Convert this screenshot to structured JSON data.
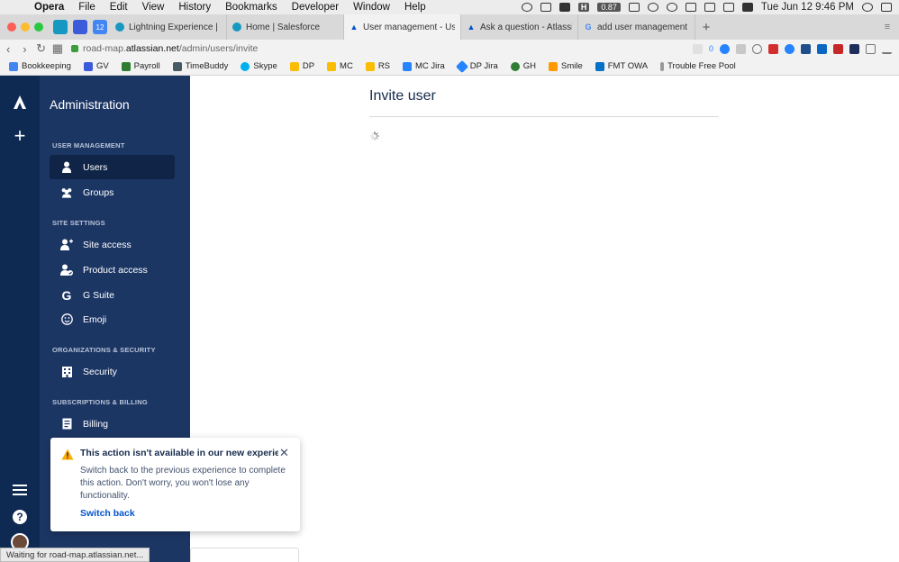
{
  "os_menubar": {
    "items": [
      "Opera",
      "File",
      "Edit",
      "View",
      "History",
      "Bookmarks",
      "Developer",
      "Window",
      "Help"
    ],
    "badge_value": "0.87",
    "clock": "Tue Jun 12  9:46 PM"
  },
  "tabs": [
    {
      "title": "Lightning Experience | Salesf",
      "icon": "salesforce-cloud"
    },
    {
      "title": "Home | Salesforce",
      "icon": "salesforce-cloud"
    },
    {
      "title": "User management - Users",
      "icon": "atlassian-logo",
      "active": true
    },
    {
      "title": "Ask a question - Atlassian Co",
      "icon": "atlassian-logo"
    },
    {
      "title": "add user management page",
      "icon": "google-g"
    }
  ],
  "address_bar": {
    "url_prefix": "road-map.",
    "url_host": "atlassian.net",
    "url_path": "/admin/users/invite",
    "ext_count": "0"
  },
  "bookmarks": [
    {
      "label": "Bookkeeping",
      "color": "#4285f4"
    },
    {
      "label": "GV",
      "color": "#3b5bdb"
    },
    {
      "label": "Payroll",
      "color": "#2e7d32"
    },
    {
      "label": "TimeBuddy",
      "color": "#455a64"
    },
    {
      "label": "Skype",
      "color": "#00aff0"
    },
    {
      "label": "DP",
      "color": "#fbbc04"
    },
    {
      "label": "MC",
      "color": "#fbbc04"
    },
    {
      "label": "RS",
      "color": "#fbbc04"
    },
    {
      "label": "MC Jira",
      "color": "#2684ff"
    },
    {
      "label": "DP Jira",
      "color": "#2684ff"
    },
    {
      "label": "GH",
      "color": "#2e7d32"
    },
    {
      "label": "Smile",
      "color": "#ff9900"
    },
    {
      "label": "FMT OWA",
      "color": "#0072c6"
    },
    {
      "label": "Trouble Free Pool",
      "color": "#999999"
    }
  ],
  "sidebar": {
    "title": "Administration",
    "sections": [
      {
        "heading": "USER MANAGEMENT",
        "items": [
          {
            "label": "Users",
            "icon": "user-icon",
            "active": true
          },
          {
            "label": "Groups",
            "icon": "groups-icon"
          }
        ]
      },
      {
        "heading": "SITE SETTINGS",
        "items": [
          {
            "label": "Site access",
            "icon": "user-add-icon"
          },
          {
            "label": "Product access",
            "icon": "user-check-icon"
          },
          {
            "label": "G Suite",
            "icon": "google-g-icon"
          },
          {
            "label": "Emoji",
            "icon": "emoji-icon"
          }
        ]
      },
      {
        "heading": "ORGANIZATIONS & SECURITY",
        "items": [
          {
            "label": "Security",
            "icon": "building-icon"
          }
        ]
      },
      {
        "heading": "SUBSCRIPTIONS & BILLING",
        "items": [
          {
            "label": "Billing",
            "icon": "document-icon"
          }
        ]
      }
    ]
  },
  "main": {
    "title": "Invite user"
  },
  "flag": {
    "title": "This action isn't available in our new experie...",
    "body": "Switch back to the previous experience to complete this action. Don't worry, you won't lose any functionality.",
    "action": "Switch back"
  },
  "status_bar": {
    "text": "Waiting for road-map.atlassian.net..."
  },
  "colors": {
    "rail": "#0e2a53",
    "sidebar": "#1c3664",
    "link": "#0052cc",
    "warning": "#ffab00"
  }
}
